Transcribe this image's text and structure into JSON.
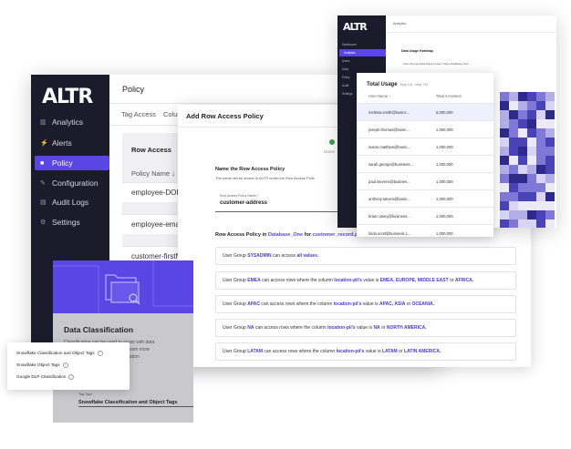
{
  "app": {
    "logo": "ALTR",
    "page_title": "Policy",
    "sidebar": [
      "Analytics",
      "Alerts",
      "Policy",
      "Configuration",
      "Audit Logs",
      "Settings"
    ],
    "tabs": [
      "Tag Access",
      "Column A"
    ],
    "row_access": {
      "title": "Row Access",
      "column_header": "Policy Name",
      "rows": [
        "employee-DOB",
        "employee-email",
        "customer-firstN"
      ]
    }
  },
  "dialog": {
    "title": "Add Row Access Policy",
    "step_label": "Name",
    "section_title": "Name the Row Access Policy",
    "section_hint": "The name will be shown in ALTR under the Row Access Polic",
    "field_label": "Row Access Policy Name *",
    "field_value": "customer-address",
    "summary": {
      "prefix": "Row Access Policy in",
      "database": "Database_One",
      "for": "for",
      "table": "customer_record.private",
      "based": "based on",
      "column": "location-pii."
    },
    "rules": [
      {
        "pre": "User Group",
        "group": "SYSADMIN",
        "mid": "can access",
        "tail": "all values."
      },
      {
        "pre": "User Group",
        "group": "EMEA",
        "mid": "can access rows where the column",
        "col": "location-pii's",
        "val": "value is",
        "vals": "EMEA, EUROPE, MIDDLE EAST",
        "or": "or",
        "last": "AFRICA."
      },
      {
        "pre": "User Group",
        "group": "APAC",
        "mid": "can access rows where the column",
        "col": "location-pii's",
        "val": "value is",
        "vals": "APAC, ASIA",
        "or": "or",
        "last": "OCEANIA."
      },
      {
        "pre": "User Group",
        "group": "NA",
        "mid": "can access rows where the column",
        "col": "location-pii's",
        "val": "value is",
        "vals": "NA",
        "or": "or",
        "last": "NORTH AMERICA."
      },
      {
        "pre": "User Group",
        "group": "LATAM",
        "mid": "can access rows where the column",
        "col": "location-pii's",
        "val": "value is",
        "vals": "LATAM",
        "or": "or",
        "last": "LATIN AMERICA."
      }
    ]
  },
  "analytics": {
    "header": "Analytics",
    "nav": [
      "Dashboard",
      "Analytics",
      "Users",
      "Data",
      "Policy",
      "Audit",
      "Settings"
    ],
    "heatmap_title": "Data Usage Heatmap",
    "filters": "User Groups  Data Source  Last 7 Days  Database One"
  },
  "total_usage": {
    "title": "Total Usage",
    "range": "May 1st - May 7th",
    "col_user": "User Name",
    "col_total": "Total Accesses",
    "rows": [
      {
        "user": "melissa.smith@businc...",
        "total": "5,000,000"
      },
      {
        "user": "joseph.thomas@busin...",
        "total": "1,000,000"
      },
      {
        "user": "susan.matthew@busin...",
        "total": "1,000,000"
      },
      {
        "user": "sarah.george@business...",
        "total": "1,000,000"
      },
      {
        "user": "paul.stevens@busines...",
        "total": "1,000,000"
      },
      {
        "user": "anthony.steven@busin...",
        "total": "1,000,000"
      },
      {
        "user": "brian.casey@business...",
        "total": "1,000,000"
      },
      {
        "user": "linda.scott@business.c...",
        "total": "1,000,000"
      }
    ]
  },
  "classification": {
    "title": "Data Classification",
    "desc1": "Classification can be used to assist with data",
    "desc2": "e. To learn more",
    "desc3": "umentation",
    "sub": "ication",
    "tag_label": "Tag Type",
    "tag_value": "Snowflake Classification and Object Tags",
    "options": [
      "Snowflake Classification and Object Tags",
      "Snowflake Object Tags",
      "Google DLP Classification"
    ]
  },
  "colors": {
    "accent": "#5a46e4",
    "sidebar": "#1b1b2b"
  }
}
